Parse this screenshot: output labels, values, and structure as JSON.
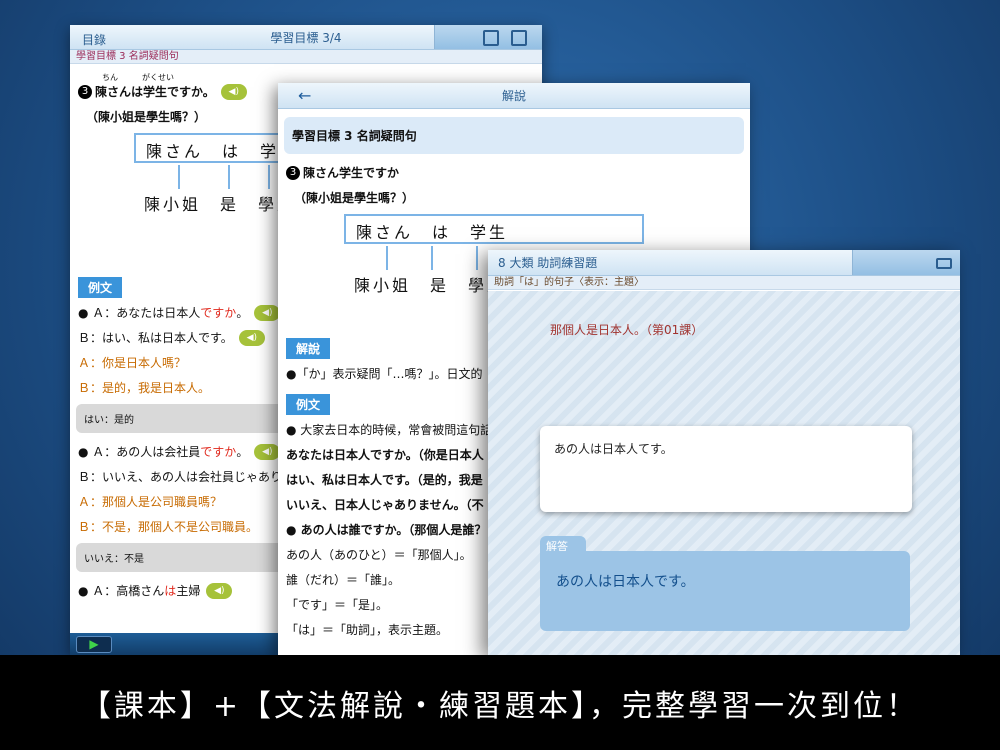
{
  "panel1": {
    "toc_label": "目錄",
    "title": "學習目標 3/4",
    "subheader": "學習目標 3 名詞疑問句",
    "furigana_1": "ちん　　　がくせい",
    "sentence": "陳さんは学生ですか。",
    "translation": "（陳小姐是學生嗎？）",
    "diagram_top": "陳さん　は　学生",
    "diagram_bottom": "陳小姐　是　學生",
    "example_badge": "例文",
    "ex1_a_prefix": "● Ａ：あなたは日本人",
    "ex1_a_red": "ですか",
    "ex1_a_end": "。",
    "ex1_b": "Ｂ：はい、私は日本人です。",
    "ex1_trans_a": "Ａ：你是日本人嗎？",
    "ex1_trans_b": "Ｂ：是的，我是日本人。",
    "hint1": "はい：是的",
    "ex2_a_prefix": "● Ａ：あの人は会社員",
    "ex2_a_red": "ですか",
    "ex2_a_end": "。",
    "ex2_b": "Ｂ：いいえ、あの人は会社員じゃあり",
    "ex2_trans_a": "Ａ：那個人是公司職員嗎？",
    "ex2_trans_b": "Ｂ：不是，那個人不是公司職員。",
    "hint2": "いいえ：不是",
    "ex3_a_prefix": "● Ａ：高橋さん",
    "ex3_a_red": "は",
    "ex3_a_end": "主婦",
    "speaker_label": "◀)",
    "play_label": "▶"
  },
  "panel2": {
    "title": "解說",
    "back_label": "←",
    "title_box": "學習目標 3 名詞疑問句",
    "sentence": "陳さん学生ですか",
    "translation": "（陳小姐是學生嗎？）",
    "diagram_top": "陳さん　は　学生",
    "diagram_bottom": "陳小姐　是　學生",
    "explain_badge": "解說",
    "explain_text": "●「か」表示疑問「…嗎？」。日文的",
    "example_badge": "例文",
    "lines": [
      "● 大家去日本的時候，常會被問這句話",
      "あなたは日本人ですか。（你是日本人",
      "はい、私は日本人です。（是的，我是",
      "いいえ、日本人じゃありません。（不",
      "● あの人は誰ですか。（那個人是誰？",
      "あの人（あのひと）＝「那個人」。",
      "誰（だれ）＝「誰」。",
      "「です」＝「是」。",
      "「は」＝「助詞」，表示主題。"
    ]
  },
  "panel3": {
    "title": "8 大類 助詞練習題",
    "subheader": "助詞「は」的句子〈表示：主題〉",
    "question": "那個人是日本人。（第01課）",
    "user_answer": "あの人は日本人てす。",
    "answer_label": "解答",
    "answer": "あの人は日本人です。"
  },
  "banner": "【課本】+【文法解說・練習題本】，完整學習一次到位！",
  "colors": {
    "accent": "#3a94da",
    "red": "#e0281c",
    "orange": "#c76a00",
    "speaker": "#a6c23a"
  }
}
